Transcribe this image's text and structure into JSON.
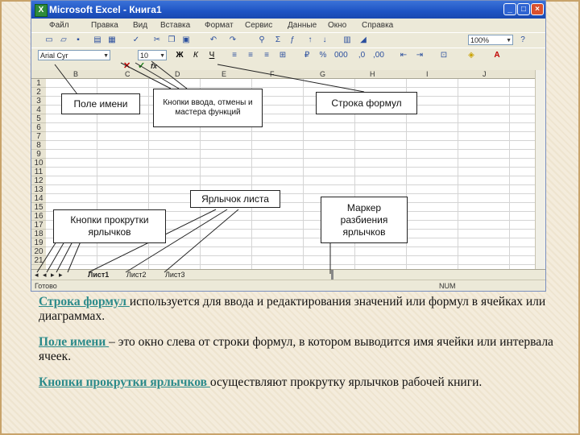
{
  "window": {
    "title": "Microsoft Excel - Книга1",
    "minimize": "_",
    "restore": "□",
    "close": "×"
  },
  "menu": [
    "Файл",
    "Правка",
    "Вид",
    "Вставка",
    "Формат",
    "Сервис",
    "Данные",
    "Окно",
    "Справка"
  ],
  "toolbar": {
    "zoom": "100%",
    "font_name": "Arial Cyr",
    "font_size": "10"
  },
  "formula_bar": {
    "buttons": [
      "✕",
      "✓",
      "fx"
    ]
  },
  "columns": [
    "B",
    "C",
    "D",
    "E",
    "F",
    "G",
    "H",
    "I",
    "J"
  ],
  "rows": [
    "1",
    "2",
    "3",
    "4",
    "5",
    "6",
    "7",
    "8",
    "9",
    "10",
    "11",
    "12",
    "13",
    "14",
    "15",
    "16",
    "17",
    "18",
    "19",
    "20",
    "21"
  ],
  "sheet_tabs": [
    "Лист1",
    "Лист2",
    "Лист3"
  ],
  "status": {
    "left": "Готово",
    "right": "NUM"
  },
  "callouts": {
    "name_box": "Поле имени",
    "buttons": "Кнопки ввода, отмены и мастера функций",
    "formula_bar": "Строка формул",
    "sheet_tab": "Ярлычок листа",
    "scroll_buttons": "Кнопки прокрутки ярлычков",
    "split_marker": "Маркер разбиения ярлычков"
  },
  "descriptions": [
    {
      "term": "Строка формул ",
      "text": "используется для ввода и редактирования значений или формул в ячейках или диаграммах."
    },
    {
      "term": "Поле имени ",
      "text": "– это окно слева от строки формул, в котором выводится имя ячейки или интервала ячеек."
    },
    {
      "term": "Кнопки прокрутки ярлычков ",
      "text": "осуществляют прокрутку ярлычков рабочей книги."
    }
  ],
  "colors": {
    "term": "#2b8a8a",
    "title_bar": "#1f54c4",
    "slide_border": "#c8a36a"
  }
}
